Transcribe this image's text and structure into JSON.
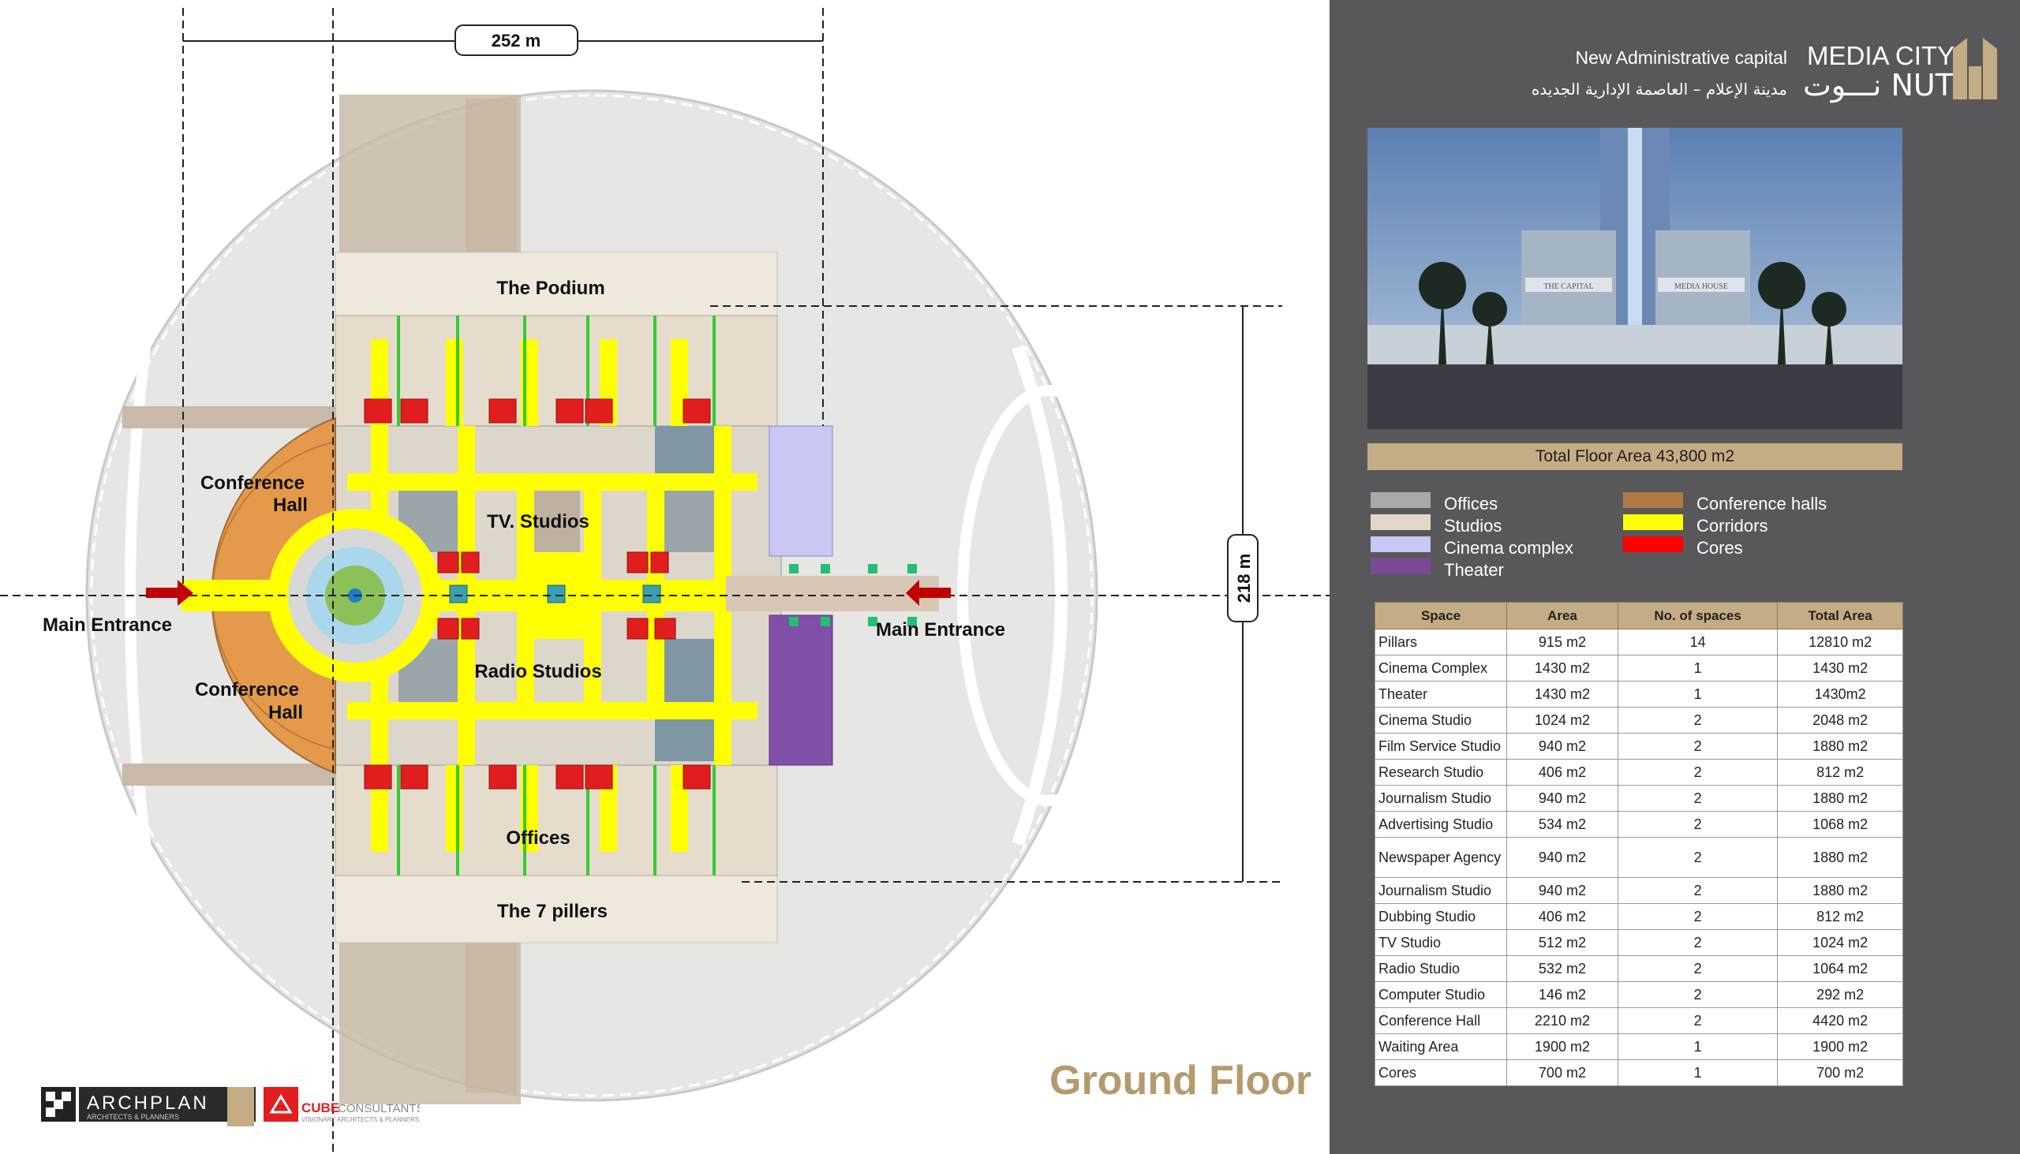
{
  "header": {
    "subtitle_en": "New Administrative capital",
    "subtitle_ar": "مدينة الإعلام – العاصمة الإدارية الجديده",
    "brand_line1": "MEDIA CITY",
    "brand_line2": "نـــوت NUT"
  },
  "render_image": {
    "sign_left": "THE CAPITAL",
    "sign_right": "MEDIA HOUSE"
  },
  "total_floor_area": "Total Floor Area 43,800 m2",
  "legend": [
    {
      "label": "Offices",
      "color": "#a9a9a9"
    },
    {
      "label": "Studios",
      "color": "#e3d8c8"
    },
    {
      "label": "Cinema complex",
      "color": "#c9c7f3"
    },
    {
      "label": "Theater",
      "color": "#7a4a95"
    },
    {
      "label": "Conference halls",
      "color": "#b07a45"
    },
    {
      "label": "Corridors",
      "color": "#ffff00"
    },
    {
      "label": "Cores",
      "color": "#ff0000"
    }
  ],
  "table": {
    "headers": [
      "Space",
      "Area",
      "No. of spaces",
      "Total Area"
    ],
    "rows": [
      [
        "Pillars",
        "915 m2",
        "14",
        "12810 m2"
      ],
      [
        "Cinema Complex",
        "1430 m2",
        "1",
        "1430 m2"
      ],
      [
        "Theater",
        "1430 m2",
        "1",
        "1430m2"
      ],
      [
        "Cinema Studio",
        "1024 m2",
        "2",
        "2048 m2"
      ],
      [
        "Film Service Studio",
        "940 m2",
        "2",
        "1880 m2"
      ],
      [
        "Research Studio",
        "406 m2",
        "2",
        "812 m2"
      ],
      [
        "Journalism Studio",
        "940  m2",
        "2",
        "1880  m2"
      ],
      [
        "Advertising Studio",
        "534 m2",
        "2",
        "1068 m2"
      ],
      [
        "Newspaper Agency",
        "940 m2",
        "2",
        "1880 m2"
      ],
      [
        "Journalism Studio",
        "940 m2",
        "2",
        "1880 m2"
      ],
      [
        "Dubbing Studio",
        "406 m2",
        "2",
        "812 m2"
      ],
      [
        "TV Studio",
        "512 m2",
        "2",
        "1024 m2"
      ],
      [
        "Radio Studio",
        "532  m2",
        "2",
        "1064  m2"
      ],
      [
        "Computer Studio",
        "146 m2",
        "2",
        "292 m2"
      ],
      [
        "Conference Hall",
        "2210  m2",
        "2",
        "4420 m2"
      ],
      [
        "Waiting Area",
        "1900 m2",
        "1",
        "1900 m2"
      ],
      [
        "Cores",
        "700 m2",
        "1",
        "700 m2"
      ]
    ]
  },
  "plan": {
    "dim_width": "252 m",
    "dim_height": "218 m",
    "labels": {
      "podium": "The Podium",
      "conf1a": "Conference",
      "conf1b": "Hall",
      "conf2a": "Conference",
      "conf2b": "Hall",
      "tv": "TV. Studios",
      "radio": "Radio Studios",
      "offices": "Offices",
      "pillers": "The 7 pillers",
      "entrance_left": "Main Entrance",
      "entrance_right": "Main Entrance"
    }
  },
  "floor_title": "Ground Floor",
  "footer_logos": {
    "archplan": "ARCHPLAN",
    "archplan_sub": "ARCHITECTS & PLANNERS",
    "cube": "CUBE",
    "cube2": "CONSULTANTS",
    "cube_sub": "VISIONARY ARCHITECTS & PLANNERS"
  }
}
